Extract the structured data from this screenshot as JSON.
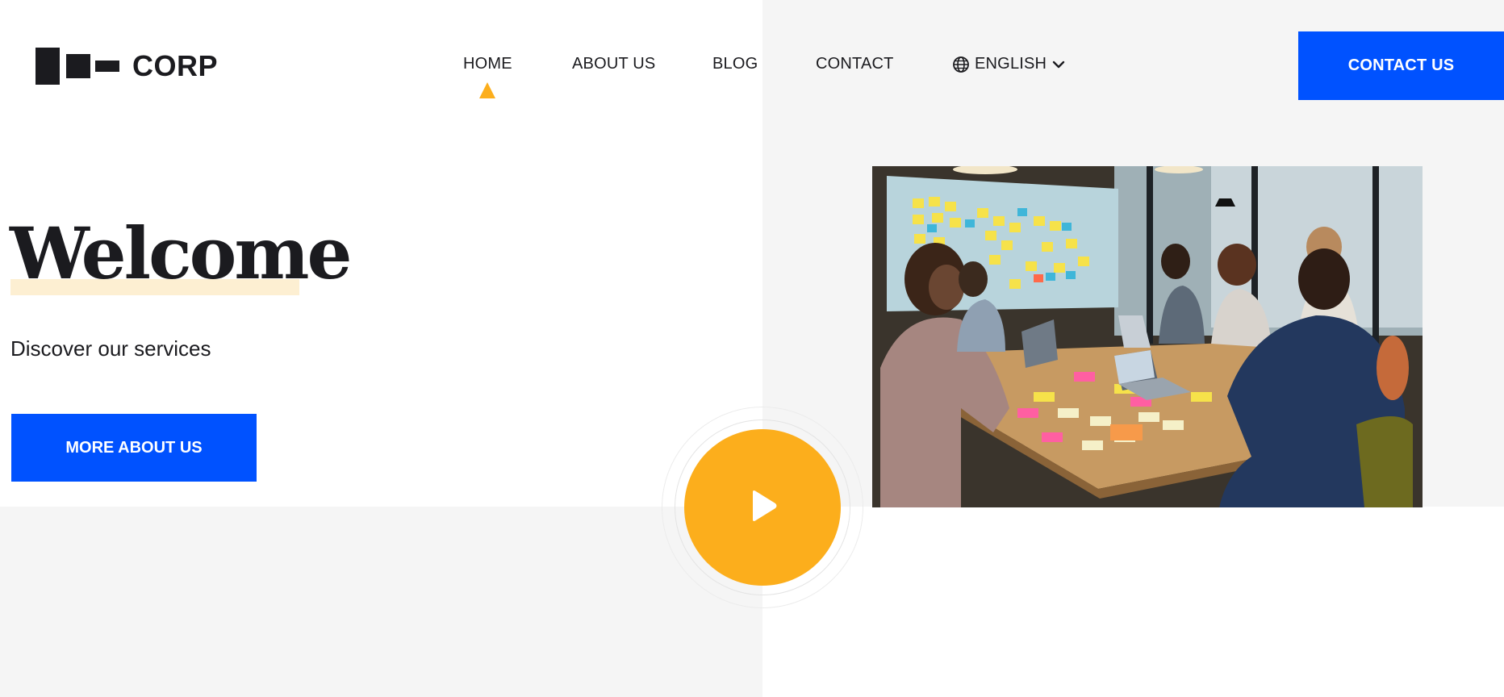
{
  "brand": {
    "name": "CORP"
  },
  "nav": {
    "items": [
      {
        "label": "HOME",
        "active": true
      },
      {
        "label": "ABOUT US"
      },
      {
        "label": "BLOG"
      },
      {
        "label": "CONTACT"
      }
    ],
    "language": {
      "label": "ENGLISH",
      "icon": "globe-icon",
      "dropdown_icon": "chevron-down-icon"
    }
  },
  "header_cta": {
    "label": "CONTACT US"
  },
  "hero": {
    "title": "Welcome",
    "subtitle": "Discover our services",
    "button_label": "MORE ABOUT US"
  },
  "media": {
    "play_icon": "play-icon",
    "image": "team-meeting-photo"
  },
  "colors": {
    "primary": "#0052ff",
    "accent": "#fcae1c",
    "text": "#1b1b1f",
    "panel_bg": "#f5f5f5",
    "highlight": "#fdefd2"
  }
}
